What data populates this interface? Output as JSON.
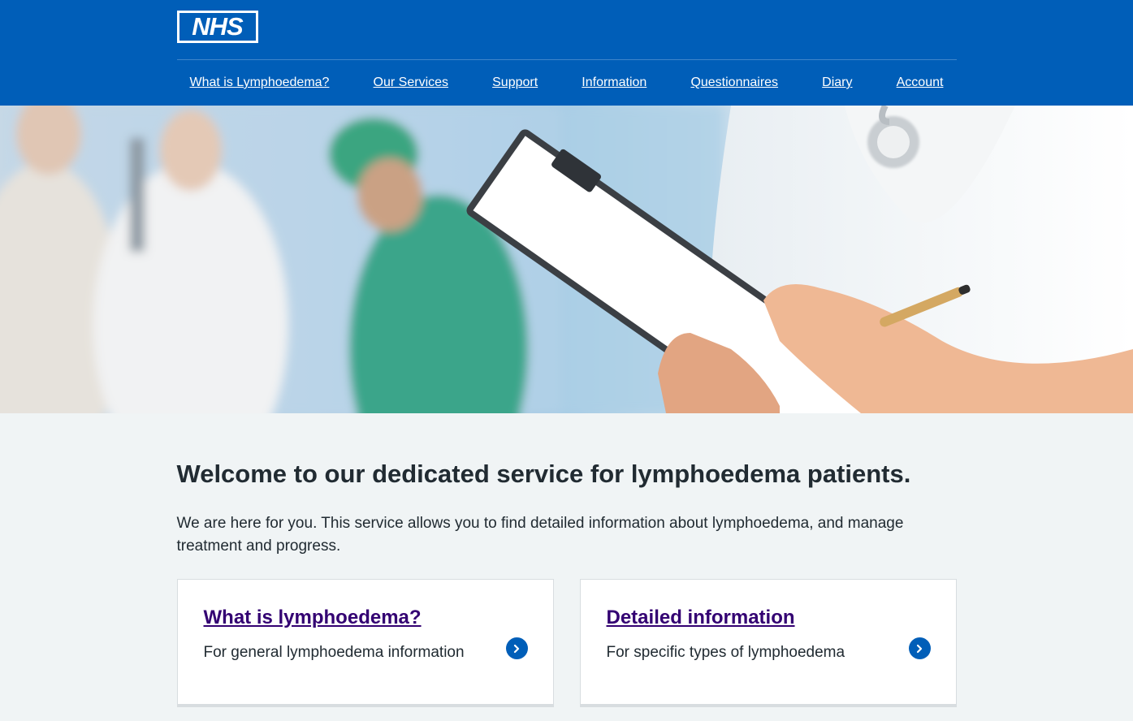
{
  "brand": {
    "logo_text": "NHS"
  },
  "nav": {
    "items": [
      {
        "label": "What is Lymphoedema?"
      },
      {
        "label": "Our Services"
      },
      {
        "label": "Support"
      },
      {
        "label": "Information"
      },
      {
        "label": "Questionnaires"
      },
      {
        "label": "Diary"
      },
      {
        "label": "Account"
      }
    ]
  },
  "hero": {
    "image": "medical-staff-with-clipboard-photo"
  },
  "main": {
    "heading": "Welcome to our dedicated service for lymphoedema patients.",
    "lead": "We are here for you. This service allows you to find detailed information about lymphoedema, and manage treatment and progress.",
    "cards": [
      {
        "title": "What is lymphoedema?",
        "description": "For general lymphoedema information",
        "icon": "chevron-right-icon"
      },
      {
        "title": "Detailed information",
        "description": "For specific types of lymphoedema",
        "icon": "chevron-right-icon"
      }
    ]
  },
  "colors": {
    "header_bg": "#005eb8",
    "page_bg": "#f0f4f5",
    "link_visited": "#330072",
    "text": "#212b32"
  }
}
